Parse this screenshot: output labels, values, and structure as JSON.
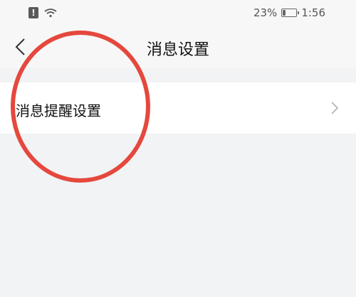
{
  "status_bar": {
    "battery_percent": "23%",
    "battery_level": 0.23,
    "time": "1:56",
    "left_icons": [
      "alert-icon",
      "wifi-icon"
    ]
  },
  "nav": {
    "title": "消息设置",
    "back_icon": "chevron-left-icon"
  },
  "settings": {
    "items": [
      {
        "label": "消息提醒设置",
        "icon": "chevron-right-icon"
      }
    ]
  },
  "colors": {
    "background": "#f2f3f5",
    "bar_background": "#f7f7f7",
    "row_background": "#ffffff",
    "annotation": "#e5483d"
  }
}
